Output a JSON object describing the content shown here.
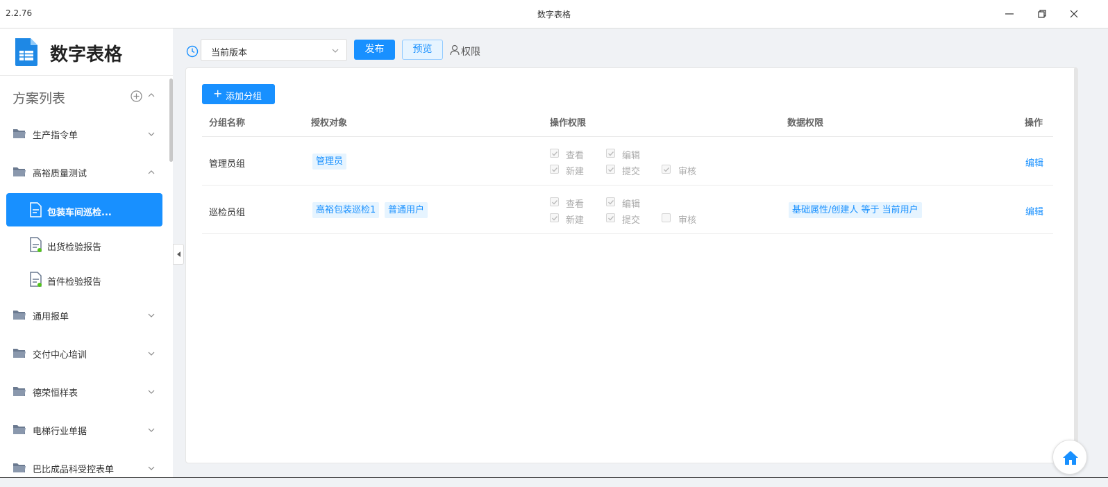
{
  "window": {
    "version": "2.2.76",
    "title": "数字表格"
  },
  "sidebar": {
    "brand": "数字表格",
    "scheme_list_label": "方案列表",
    "folders": [
      {
        "label": "生产指令单",
        "expanded": false
      },
      {
        "label": "高裕质量测试",
        "expanded": true
      },
      {
        "label": "通用报单",
        "expanded": false
      },
      {
        "label": "交付中心培训",
        "expanded": false
      },
      {
        "label": "德荣恒样表",
        "expanded": false
      },
      {
        "label": "电梯行业单据",
        "expanded": false
      },
      {
        "label": "巴比成品科受控表单",
        "expanded": false
      }
    ],
    "documents": [
      {
        "label": "包装车间巡检...",
        "active": true
      },
      {
        "label": "出货检验报告",
        "active": false
      },
      {
        "label": "首件检验报告",
        "active": false
      }
    ]
  },
  "toolbar": {
    "version_select": "当前版本",
    "publish_label": "发布",
    "preview_label": "预览",
    "permission_label": "权限"
  },
  "main": {
    "add_group_label": "添加分组",
    "columns": [
      "分组名称",
      "授权对象",
      "操作权限",
      "数据权限",
      "操作"
    ],
    "rows": [
      {
        "group_name": "管理员组",
        "targets": [
          "管理员"
        ],
        "permissions": [
          {
            "label": "查看",
            "checked": true
          },
          {
            "label": "编辑",
            "checked": true
          },
          {
            "label": "新建",
            "checked": true
          },
          {
            "label": "提交",
            "checked": true
          },
          {
            "label": "审核",
            "checked": true
          }
        ],
        "data_permission": "",
        "action": "编辑"
      },
      {
        "group_name": "巡检员组",
        "targets": [
          "高裕包装巡检1",
          "普通用户"
        ],
        "permissions": [
          {
            "label": "查看",
            "checked": true
          },
          {
            "label": "编辑",
            "checked": true
          },
          {
            "label": "新建",
            "checked": true
          },
          {
            "label": "提交",
            "checked": true
          },
          {
            "label": "审核",
            "checked": false
          }
        ],
        "data_permission": "基础属性/创建人 等于 当前用户",
        "action": "编辑"
      }
    ]
  },
  "colors": {
    "primary": "#1890ff",
    "tag_bg": "#e6f4ff",
    "status_dot": "#52c41a"
  }
}
